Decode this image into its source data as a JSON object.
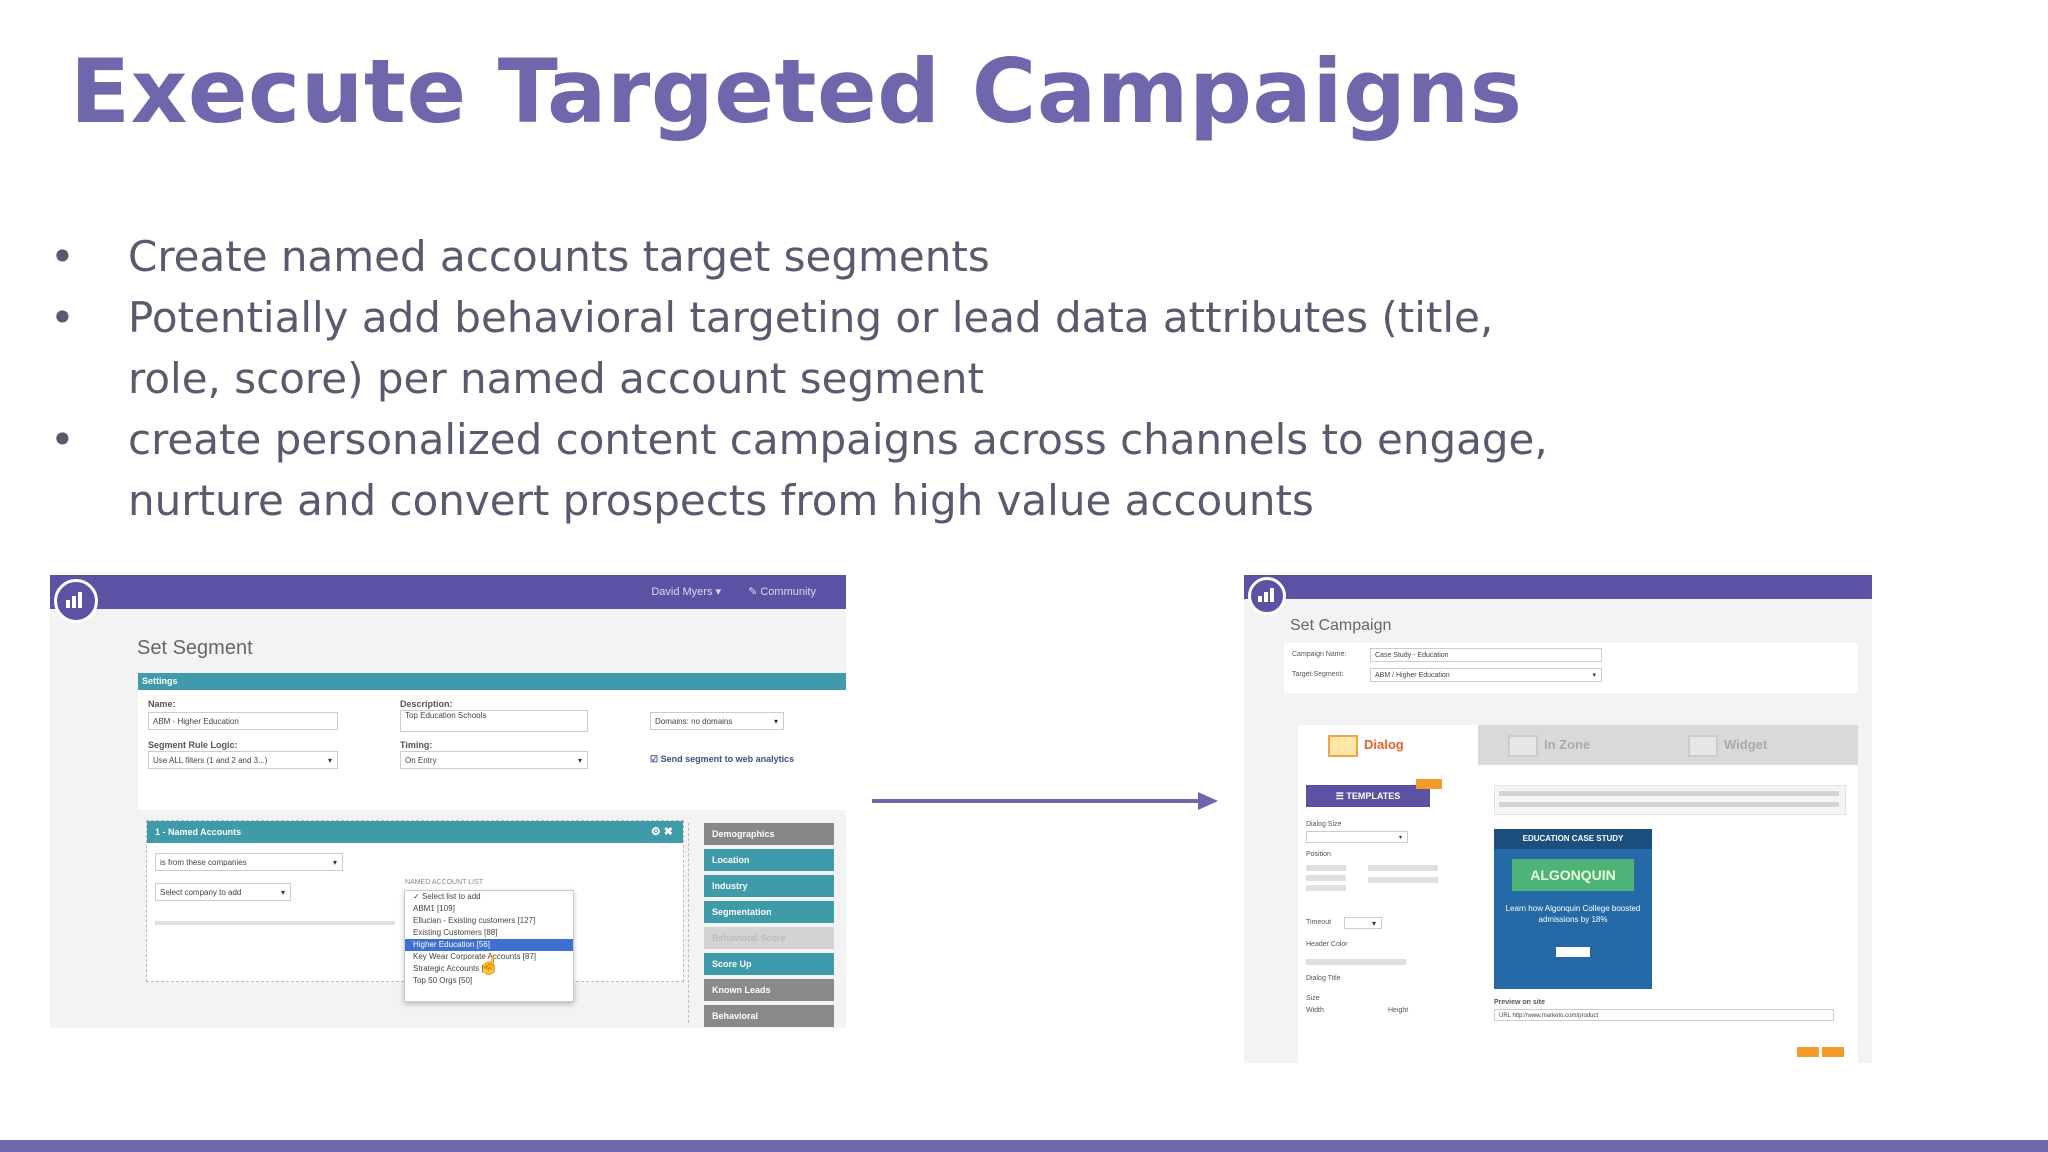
{
  "slide": {
    "title": "Execute Targeted Campaigns",
    "bullets": [
      "Create named accounts target segments",
      "Potentially add behavioral targeting or lead data attributes (title, role, score) per named account segment",
      "create personalized content campaigns across channels to engage, nurture and convert prospects from high value accounts"
    ],
    "bullet_symbol": "•"
  },
  "colors": {
    "accent": "#6e67ac",
    "body_text": "#585a6e",
    "app_header": "#5b52a3",
    "teal": "#3f9aa9"
  },
  "segment_screenshot": {
    "top_nav": [
      "David Myers ▾",
      "✎ Community"
    ],
    "heading": "Set Segment",
    "settings_label": "Settings",
    "name_label": "Name:",
    "name_value": "ABM - Higher Education",
    "description_label": "Description:",
    "description_value": "Top Education Schools",
    "domains_value": "Domains: no domains",
    "rule_logic_label": "Segment Rule Logic:",
    "rule_logic_value": "Use ALL filters (1 and 2 and 3...)",
    "timing_label": "Timing:",
    "timing_value": "On Entry",
    "analytics_label": "☑ Send segment to web analytics",
    "rule_title": "1 - Named Accounts",
    "rule_icons": "⚙ ✖",
    "rule_operator": "is from these companies",
    "company_select": "Select company to add",
    "dropdown_title": "NAMED ACCOUNT LIST",
    "dropdown_items": [
      "✓ Select list to add",
      "ABM1 [109]",
      "Ellucian - Existing customers [127]",
      "Existing Customers [88]",
      "Higher Education [56]",
      "Key Wear Corporate Accounts [87]",
      "Strategic Accounts [96]",
      "Top 50 Orgs [50]"
    ],
    "dropdown_active_index": 4,
    "sidebar_items": [
      "Demographics",
      "Location",
      "Industry",
      "Segmentation",
      "Behavioral Score",
      "Score Up",
      "Known Leads",
      "Behavioral"
    ],
    "cursor_glyph": "☝"
  },
  "campaign_screenshot": {
    "heading": "Set Campaign",
    "campaign_name_label": "Campaign Name:",
    "campaign_name_value": "Case Study - Education",
    "target_segment_label": "Target Segment:",
    "target_segment_value": "ABM / Higher Education",
    "tabs": [
      "Dialog",
      "In Zone",
      "Widget"
    ],
    "active_tab_index": 0,
    "templates_button": "☰ TEMPLATES",
    "preview_banner": "EDUCATION CASE STUDY",
    "preview_brand": "ALGONQUIN",
    "preview_copy": "Learn how Algonquin College boosted admissions by 18%",
    "preview_on_site_label": "Preview on site",
    "preview_url": "URL http://www.marketo.com/product",
    "dialog_size_label": "Dialog Size",
    "position_label": "Position",
    "timeout_label": "Timeout",
    "header_color_label": "Header Color",
    "dialog_title_label": "Dialog Title",
    "size_label": "Size",
    "width_label": "Width",
    "height_label": "Height"
  },
  "arrow": {
    "direction": "right"
  }
}
